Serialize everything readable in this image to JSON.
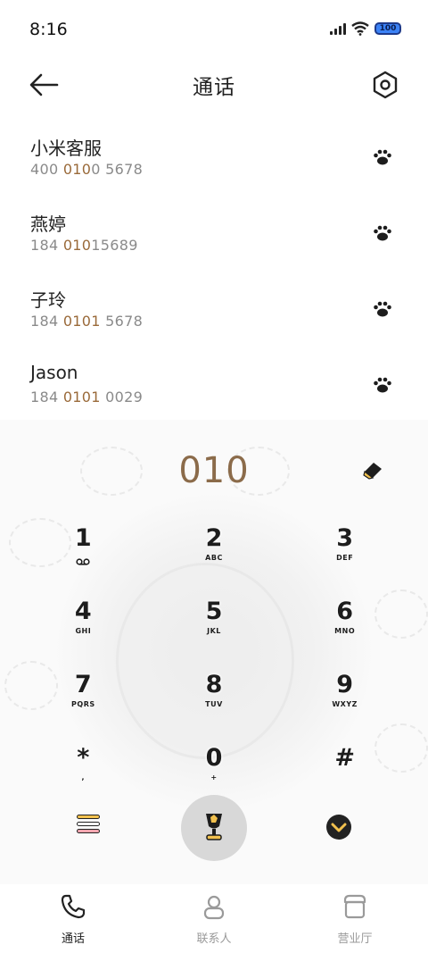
{
  "status_bar": {
    "time": "8:16",
    "battery": "100"
  },
  "header": {
    "title": "通话"
  },
  "contacts": [
    {
      "name": "小米客服",
      "num_pre": "400 ",
      "num_hl": "010",
      "num_post": "0 5678"
    },
    {
      "name": "燕婷",
      "num_pre": "184 ",
      "num_hl": "010",
      "num_post": "15689"
    },
    {
      "name": "子玲",
      "num_pre": "184 ",
      "num_hl": "0101",
      "num_post": " 5678"
    },
    {
      "name": "Jason",
      "num_pre": "184 ",
      "num_hl": "0101",
      "num_post": " 0029"
    }
  ],
  "dialer": {
    "input": "010",
    "keys": [
      {
        "digit": "1",
        "letters": ""
      },
      {
        "digit": "2",
        "letters": "ABC"
      },
      {
        "digit": "3",
        "letters": "DEF"
      },
      {
        "digit": "4",
        "letters": "GHI"
      },
      {
        "digit": "5",
        "letters": "JKL"
      },
      {
        "digit": "6",
        "letters": "MNO"
      },
      {
        "digit": "7",
        "letters": "PQRS"
      },
      {
        "digit": "8",
        "letters": "TUV"
      },
      {
        "digit": "9",
        "letters": "WXYZ"
      },
      {
        "digit": "*",
        "letters": ","
      },
      {
        "digit": "0",
        "letters": "+"
      },
      {
        "digit": "#",
        "letters": ""
      }
    ]
  },
  "nav": {
    "calls": "通话",
    "contacts": "联系人",
    "service": "营业厅"
  },
  "colors": {
    "highlight": "#9a6a3a",
    "accent_blue": "#3b82f6"
  }
}
